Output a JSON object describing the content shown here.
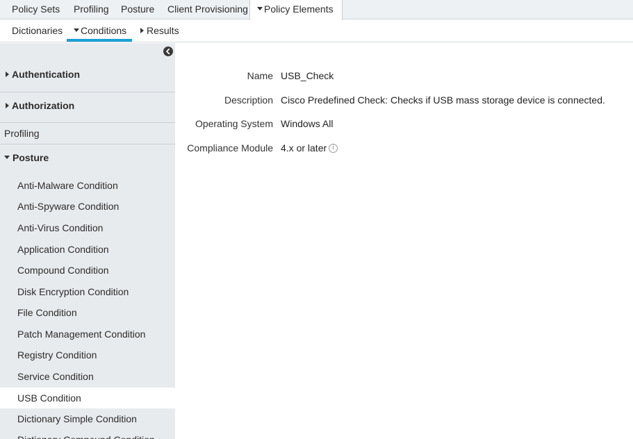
{
  "topnav": {
    "tabs": [
      "Policy Sets",
      "Profiling",
      "Posture",
      "Client Provisioning",
      "Policy Elements"
    ],
    "active": "Policy Elements"
  },
  "subnav": {
    "tabs": [
      "Dictionaries",
      "Conditions",
      "Results"
    ],
    "active": "Conditions"
  },
  "sidebar": {
    "sections": {
      "authentication": "Authentication",
      "authorization": "Authorization",
      "profiling": "Profiling",
      "posture": "Posture"
    },
    "posture_items": [
      "Anti-Malware Condition",
      "Anti-Spyware Condition",
      "Anti-Virus Condition",
      "Application Condition",
      "Compound Condition",
      "Disk Encryption Condition",
      "File Condition",
      "Patch Management Condition",
      "Registry Condition",
      "Service Condition",
      "USB Condition",
      "Dictionary Simple Condition",
      "Dictionary Compound Condition"
    ],
    "selected": "USB Condition"
  },
  "details": {
    "name_label": "Name",
    "name_value": "USB_Check",
    "description_label": "Description",
    "description_value": "Cisco Predefined Check: Checks if USB mass storage device is connected.",
    "os_label": "Operating System",
    "os_value": "Windows All",
    "module_label": "Compliance Module",
    "module_value": "4.x or later"
  },
  "colors": {
    "accent": "#1ba0d7",
    "sidebar_bg": "#e8ebee",
    "topnav_bg": "#eef1f4"
  },
  "icons": {
    "collapse": "chevron-left-circle-icon",
    "info": "info-icon",
    "expand": "caret-right-icon",
    "dropdown": "caret-down-icon"
  }
}
